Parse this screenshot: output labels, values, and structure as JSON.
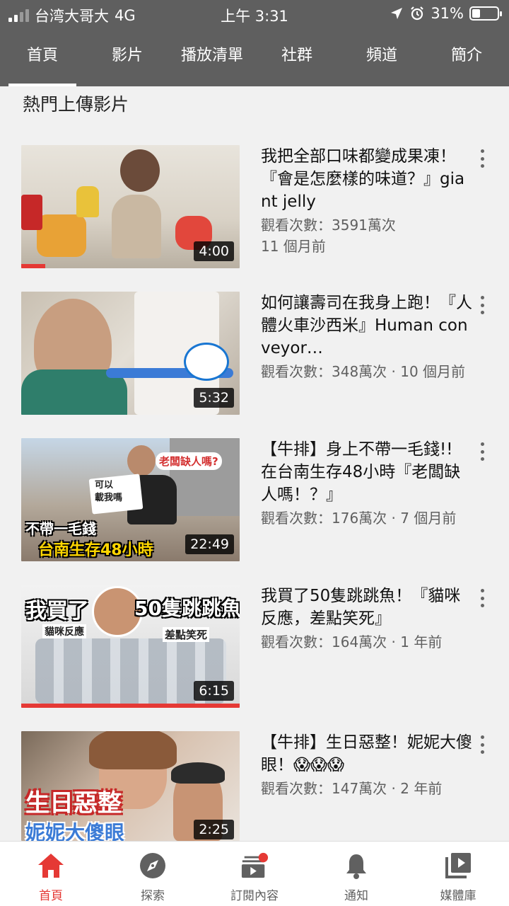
{
  "status_bar": {
    "carrier": "台湾大哥大",
    "network": "4G",
    "time": "上午 3:31",
    "battery": "31%",
    "battery_level": 0.31,
    "icons": [
      "signal-icon",
      "location-icon",
      "alarm-icon",
      "battery-icon"
    ]
  },
  "tabs": [
    {
      "label": "首頁",
      "active": true
    },
    {
      "label": "影片",
      "active": false
    },
    {
      "label": "播放清單",
      "active": false
    },
    {
      "label": "社群",
      "active": false
    },
    {
      "label": "頻道",
      "active": false
    },
    {
      "label": "簡介",
      "active": false
    }
  ],
  "section": {
    "title": "熱門上傳影片"
  },
  "videos": [
    {
      "title": "我把全部口味都變成果凍！『會是怎麼樣的味道？』giant jelly",
      "views": "觀看次數：3591萬次",
      "age": "11 個月前",
      "duration": "4:00",
      "watched_fraction": 0.11
    },
    {
      "title": "如何讓壽司在我身上跑！『人體火車沙西米』Human conveyor…",
      "views": "觀看次數：348萬次 · 10 個月前",
      "age": "",
      "duration": "5:32",
      "watched_fraction": 0
    },
    {
      "title": "【牛排】身上不帶一毛錢!! 在台南生存48小時『老闆缺人嗎！？』",
      "views": "觀看次數：176萬次 · 7 個月前",
      "age": "",
      "duration": "22:49",
      "watched_fraction": 0,
      "thumb_text": [
        "老闆缺人嗎?",
        "可以\n載我嗎",
        "不帶一毛錢",
        "台南生存48小時"
      ]
    },
    {
      "title": "我買了50隻跳跳魚！『貓咪反應，差點笑死』",
      "views": "觀看次數：164萬次 · 1 年前",
      "age": "",
      "duration": "6:15",
      "watched_fraction": 1.0,
      "thumb_text": [
        "我買了",
        "50隻跳跳魚",
        "貓咪反應",
        "差點笑死"
      ]
    },
    {
      "title": "【牛排】生日惡整！妮妮大傻眼！😱😱😱",
      "views": "觀看次數：147萬次 · 2 年前",
      "age": "",
      "duration": "2:25",
      "watched_fraction": 0,
      "thumb_text": [
        "生日惡整",
        "妮妮大傻眼"
      ]
    }
  ],
  "bottom_nav": [
    {
      "label": "首頁",
      "icon": "home-icon",
      "active": true
    },
    {
      "label": "探索",
      "icon": "compass-icon",
      "active": false
    },
    {
      "label": "訂閱內容",
      "icon": "subscriptions-icon",
      "active": false
    },
    {
      "label": "通知",
      "icon": "bell-icon",
      "active": false
    },
    {
      "label": "媒體庫",
      "icon": "library-icon",
      "active": false
    }
  ],
  "colors": {
    "header": "#5f5f5f",
    "accent": "#e53935",
    "meta_text": "#606060"
  }
}
